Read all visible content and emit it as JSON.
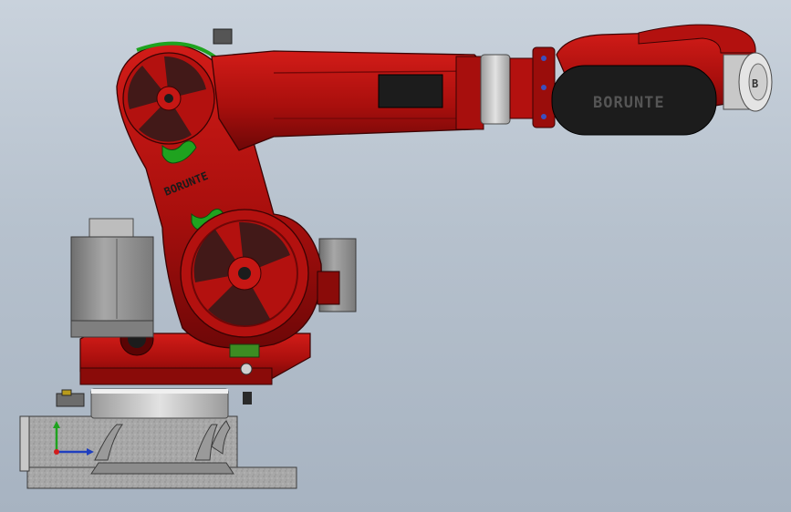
{
  "viewport": {
    "background_top": "#c9d2dc",
    "background_bottom": "#a7b3c1"
  },
  "model": {
    "brand_forearm": "BORUNTE",
    "brand_upper_arm": "BORUNTE",
    "brand_wrist": "B"
  },
  "triad": {
    "x_color": "#1f3fbf",
    "y_color": "#1fa31f",
    "z_color": "#d21c1c"
  },
  "colors": {
    "robot_red": "#b3110f",
    "robot_dark_red": "#6e0707",
    "cover_black": "#1c1c1c",
    "accent_green": "#1fa31f",
    "base_grey": "#a9a9a9",
    "motor_grey": "#8e8e8e"
  }
}
